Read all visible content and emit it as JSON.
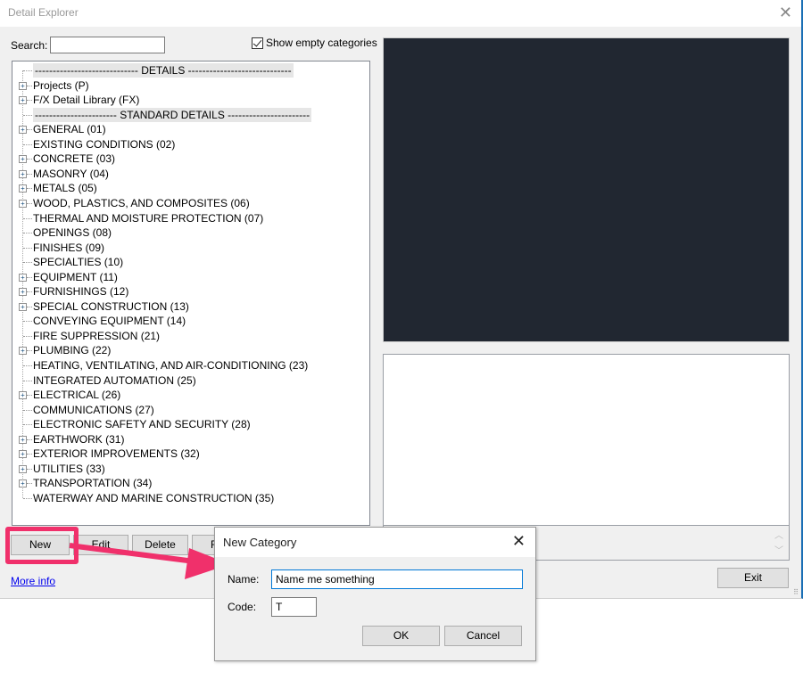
{
  "window": {
    "title": "Detail Explorer",
    "close_icon": "close-icon"
  },
  "search": {
    "label": "Search:",
    "value": "",
    "placeholder": ""
  },
  "show_empty": {
    "label": "Show empty categories",
    "checked": true
  },
  "tree": {
    "items": [
      {
        "label": "----------------------------- DETAILS -----------------------------",
        "type": "separator",
        "expandable": false
      },
      {
        "label": "Projects (P)",
        "type": "node",
        "expandable": true
      },
      {
        "label": "F/X Detail Library (FX)",
        "type": "node",
        "expandable": true
      },
      {
        "label": "----------------------- STANDARD DETAILS -----------------------",
        "type": "separator",
        "expandable": false
      },
      {
        "label": "GENERAL (01)",
        "type": "node",
        "expandable": true
      },
      {
        "label": "EXISTING CONDITIONS (02)",
        "type": "node",
        "expandable": false
      },
      {
        "label": "CONCRETE (03)",
        "type": "node",
        "expandable": true
      },
      {
        "label": "MASONRY (04)",
        "type": "node",
        "expandable": true
      },
      {
        "label": "METALS (05)",
        "type": "node",
        "expandable": true
      },
      {
        "label": "WOOD, PLASTICS, AND COMPOSITES (06)",
        "type": "node",
        "expandable": true
      },
      {
        "label": "THERMAL AND MOISTURE PROTECTION (07)",
        "type": "node",
        "expandable": false
      },
      {
        "label": "OPENINGS (08)",
        "type": "node",
        "expandable": false
      },
      {
        "label": "FINISHES (09)",
        "type": "node",
        "expandable": false
      },
      {
        "label": "SPECIALTIES (10)",
        "type": "node",
        "expandable": false
      },
      {
        "label": "EQUIPMENT (11)",
        "type": "node",
        "expandable": true
      },
      {
        "label": "FURNISHINGS (12)",
        "type": "node",
        "expandable": true
      },
      {
        "label": "SPECIAL CONSTRUCTION (13)",
        "type": "node",
        "expandable": true
      },
      {
        "label": "CONVEYING EQUIPMENT (14)",
        "type": "node",
        "expandable": false
      },
      {
        "label": "FIRE SUPPRESSION (21)",
        "type": "node",
        "expandable": false
      },
      {
        "label": "PLUMBING (22)",
        "type": "node",
        "expandable": true
      },
      {
        "label": "HEATING, VENTILATING, AND AIR-CONDITIONING (23)",
        "type": "node",
        "expandable": false
      },
      {
        "label": "INTEGRATED AUTOMATION (25)",
        "type": "node",
        "expandable": false
      },
      {
        "label": "ELECTRICAL (26)",
        "type": "node",
        "expandable": true
      },
      {
        "label": "COMMUNICATIONS (27)",
        "type": "node",
        "expandable": false
      },
      {
        "label": "ELECTRONIC SAFETY AND SECURITY (28)",
        "type": "node",
        "expandable": false
      },
      {
        "label": "EARTHWORK (31)",
        "type": "node",
        "expandable": true
      },
      {
        "label": "EXTERIOR IMPROVEMENTS (32)",
        "type": "node",
        "expandable": true
      },
      {
        "label": "UTILITIES (33)",
        "type": "node",
        "expandable": true
      },
      {
        "label": "TRANSPORTATION (34)",
        "type": "node",
        "expandable": true
      },
      {
        "label": "WATERWAY AND MARINE CONSTRUCTION (35)",
        "type": "node",
        "expandable": false
      }
    ]
  },
  "buttons": {
    "new": "New",
    "edit": "Edit",
    "delete": "Delete",
    "partial": "R",
    "exit": "Exit"
  },
  "more_info": "More info",
  "annotation": {
    "highlight_color": "#f0306b"
  },
  "dialog": {
    "title": "New Category",
    "name_label": "Name:",
    "name_value": "Name me something",
    "code_label": "Code:",
    "code_value": "T",
    "ok": "OK",
    "cancel": "Cancel"
  },
  "colors": {
    "preview_bg": "#212731",
    "accent_border": "#1a6fb5",
    "focus_border": "#0078d7"
  }
}
